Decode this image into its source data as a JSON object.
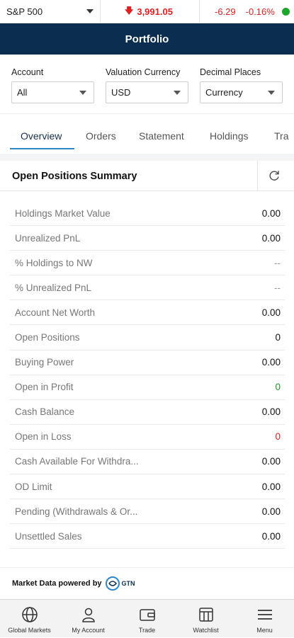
{
  "ticker": {
    "index_name": "S&P 500",
    "price": "3,991.05",
    "change": "-6.29",
    "change_pct": "-0.16%",
    "down_color": "#e02020",
    "status_color": "#1ea52b"
  },
  "header": {
    "title": "Portfolio",
    "bg_color": "#0b2d4f"
  },
  "filters": {
    "account": {
      "label": "Account",
      "value": "All"
    },
    "currency": {
      "label": "Valuation Currency",
      "value": "USD"
    },
    "decimals": {
      "label": "Decimal Places",
      "value": "Currency"
    }
  },
  "tabs": [
    "Overview",
    "Orders",
    "Statement",
    "Holdings",
    "Tra"
  ],
  "active_tab": "Overview",
  "summary": {
    "title": "Open Positions Summary",
    "rows": [
      {
        "label": "Holdings Market Value",
        "value": "0.00"
      },
      {
        "label": "Unrealized PnL",
        "value": "0.00"
      },
      {
        "label": "% Holdings to NW",
        "value": "--"
      },
      {
        "label": "% Unrealized PnL",
        "value": "--"
      },
      {
        "label": "Account Net Worth",
        "value": "0.00"
      },
      {
        "label": "Open Positions",
        "value": "0"
      },
      {
        "label": "Buying Power",
        "value": "0.00"
      },
      {
        "label": "Open in Profit",
        "value": "0"
      },
      {
        "label": "Cash Balance",
        "value": "0.00"
      },
      {
        "label": "Open in Loss",
        "value": "0"
      },
      {
        "label": "Cash Available For Withdra...",
        "value": "0.00"
      },
      {
        "label": "OD Limit",
        "value": "0.00"
      },
      {
        "label": "Pending (Withdrawals & Or...",
        "value": "0.00"
      },
      {
        "label": "Unsettled Sales",
        "value": "0.00"
      }
    ]
  },
  "footer": {
    "powered_text": "Market Data powered by",
    "brand": "GTN"
  },
  "nav": [
    "Global Markets",
    "My Account",
    "Trade",
    "Watchlist",
    "Menu"
  ]
}
